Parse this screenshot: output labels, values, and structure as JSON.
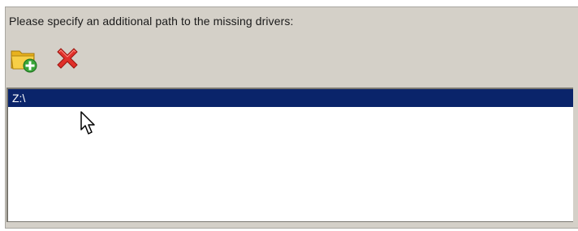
{
  "dialog": {
    "prompt": "Please specify an additional path to the missing drivers:"
  },
  "toolbar": {
    "add_icon": "folder-add-icon",
    "remove_icon": "delete-x-icon"
  },
  "paths": {
    "items": [
      "Z:\\"
    ],
    "selected_index": 0
  },
  "colors": {
    "panel": "#d4d0c8",
    "selection": "#0a246a",
    "remove_red": "#e0302a",
    "folder_yellow": "#f2c230",
    "add_green": "#3aa63a"
  }
}
